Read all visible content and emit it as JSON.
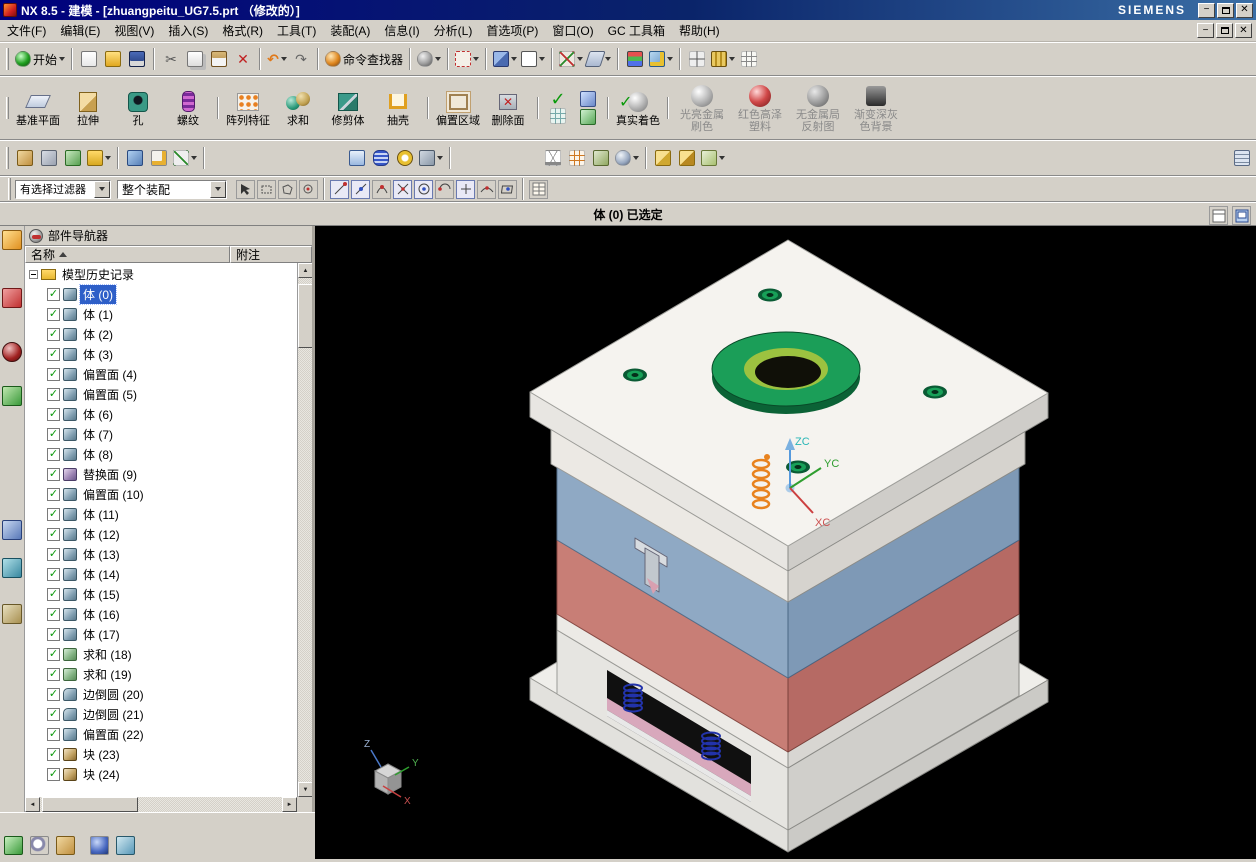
{
  "window": {
    "title": "NX 8.5 - 建模 - [zhuangpeitu_UG7.5.prt （修改的）]",
    "brand": "SIEMENS"
  },
  "icons": {
    "check": "✓",
    "close": "✕",
    "minimize": "−",
    "undo": "↶",
    "redo": "↷",
    "cut": "✂",
    "delete": "✕",
    "sort_asc": "",
    "up": "▲",
    "down": "▼",
    "left": "◄",
    "right": "►"
  },
  "menu": {
    "items": [
      "文件(F)",
      "编辑(E)",
      "视图(V)",
      "插入(S)",
      "格式(R)",
      "工具(T)",
      "装配(A)",
      "信息(I)",
      "分析(L)",
      "首选项(P)",
      "窗口(O)",
      "GC 工具箱",
      "帮助(H)"
    ]
  },
  "toolbar_standard": {
    "start_label": "开始",
    "command_finder_label": "命令查找器"
  },
  "toolbar_feature": {
    "items": [
      "基准平面",
      "拉伸",
      "孔",
      "螺纹",
      "阵列特征",
      "求和",
      "修剪体",
      "抽壳",
      "偏置区域",
      "删除面"
    ]
  },
  "toolbar_shading": {
    "items": [
      "真实着色",
      "光亮金属刷色",
      "红色高泽塑料",
      "无金属局反射图",
      "渐变深灰色背景"
    ]
  },
  "selection_bar": {
    "filter_value": "有选择过滤器",
    "scope_value": "整个装配"
  },
  "status_bar": {
    "message": "体 (0) 已选定"
  },
  "navigator": {
    "title": "部件导航器",
    "columns": {
      "name": "名称",
      "note": "附注"
    },
    "root_label": "模型历史记录",
    "items": [
      {
        "label": "体 (0)",
        "selected": true
      },
      {
        "label": "体 (1)"
      },
      {
        "label": "体 (2)"
      },
      {
        "label": "体 (3)"
      },
      {
        "label": "偏置面 (4)"
      },
      {
        "label": "偏置面 (5)"
      },
      {
        "label": "体 (6)"
      },
      {
        "label": "体 (7)"
      },
      {
        "label": "体 (8)"
      },
      {
        "label": "替换面 (9)"
      },
      {
        "label": "偏置面 (10)"
      },
      {
        "label": "体 (11)"
      },
      {
        "label": "体 (12)"
      },
      {
        "label": "体 (13)"
      },
      {
        "label": "体 (14)"
      },
      {
        "label": "体 (15)"
      },
      {
        "label": "体 (16)"
      },
      {
        "label": "体 (17)"
      },
      {
        "label": "求和 (18)"
      },
      {
        "label": "求和 (19)"
      },
      {
        "label": "边倒圆 (20)"
      },
      {
        "label": "边倒圆 (21)"
      },
      {
        "label": "偏置面 (22)"
      },
      {
        "label": "块 (23)"
      },
      {
        "label": "块 (24)"
      }
    ]
  },
  "viewport": {
    "wcs_labels": {
      "z": "ZC",
      "y": "YC",
      "x": "XC"
    },
    "triad_labels": {
      "z": "Z",
      "y": "Y",
      "x": "X"
    }
  }
}
